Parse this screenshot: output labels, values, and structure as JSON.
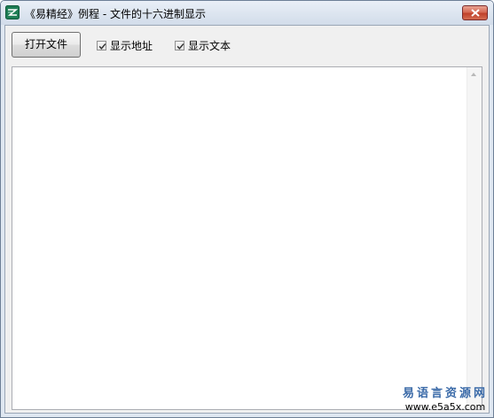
{
  "window": {
    "title": "《易精经》例程 - 文件的十六进制显示",
    "icon": "app-icon",
    "close_icon": "close-icon"
  },
  "toolbar": {
    "open_file_label": "打开文件",
    "show_address_label": "显示地址",
    "show_address_checked": true,
    "show_text_label": "显示文本",
    "show_text_checked": true
  },
  "content": {
    "text": ""
  },
  "watermark": {
    "name": "易语言资源网",
    "url": "www.e5a5x.com"
  },
  "colors": {
    "close_button": "#c9503a",
    "watermark_text": "#3a6aa8"
  }
}
